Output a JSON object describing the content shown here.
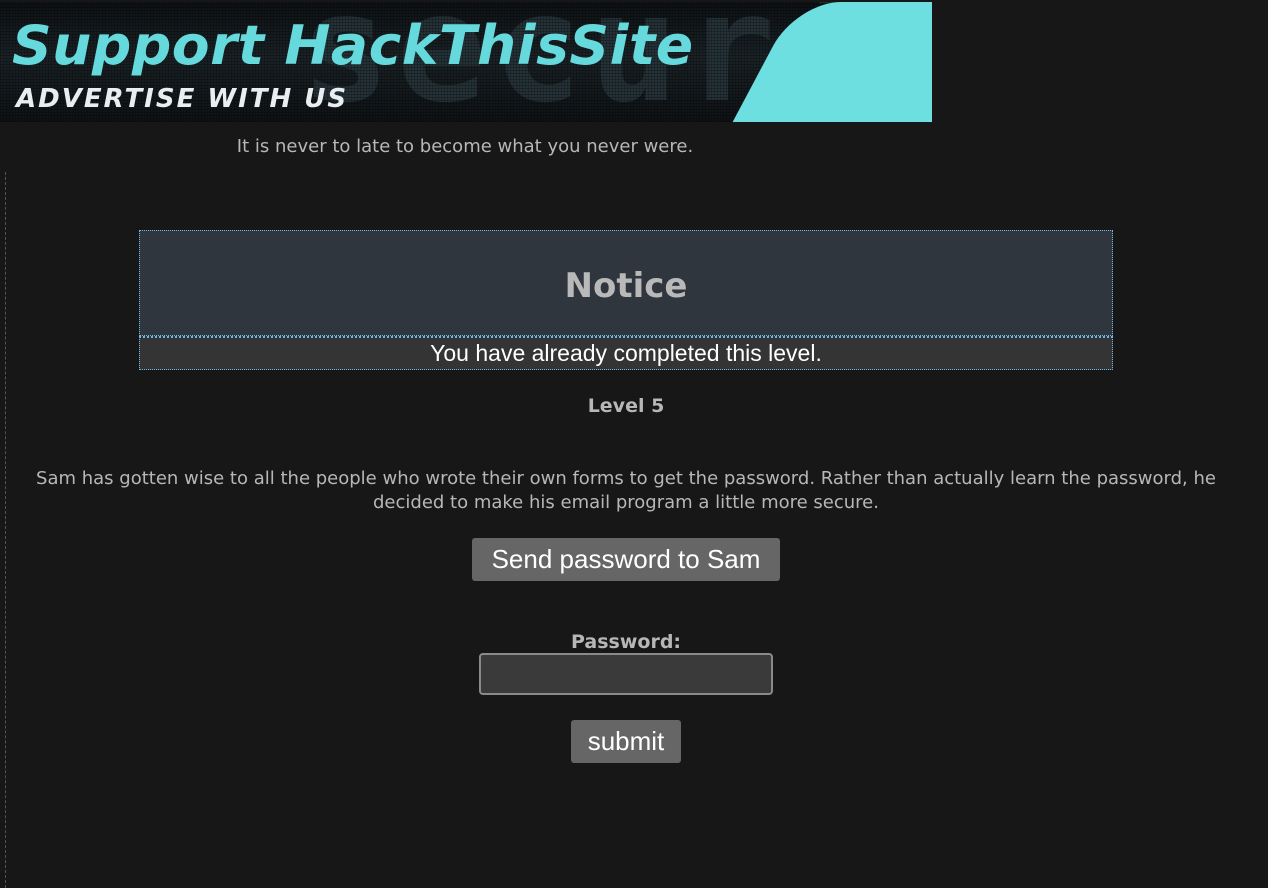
{
  "banner": {
    "title": "Support HackThisSite",
    "subtitle": "ADVERTISE WITH US",
    "background_text": "security",
    "accent_color": "#6ddfe0"
  },
  "quote": "It is never to late to become what you never were.",
  "notice": {
    "title": "Notice",
    "message": "You have already completed this level.",
    "border_color": "#6fb6e8"
  },
  "level": {
    "title": "Level 5",
    "description": "Sam has gotten wise to all the people who wrote their own forms to get the password. Rather than actually learn the password, he decided to make his email program a little more secure."
  },
  "form": {
    "send_button": "Send password to Sam",
    "password_label": "Password:",
    "password_value": "",
    "submit_button": "submit"
  }
}
